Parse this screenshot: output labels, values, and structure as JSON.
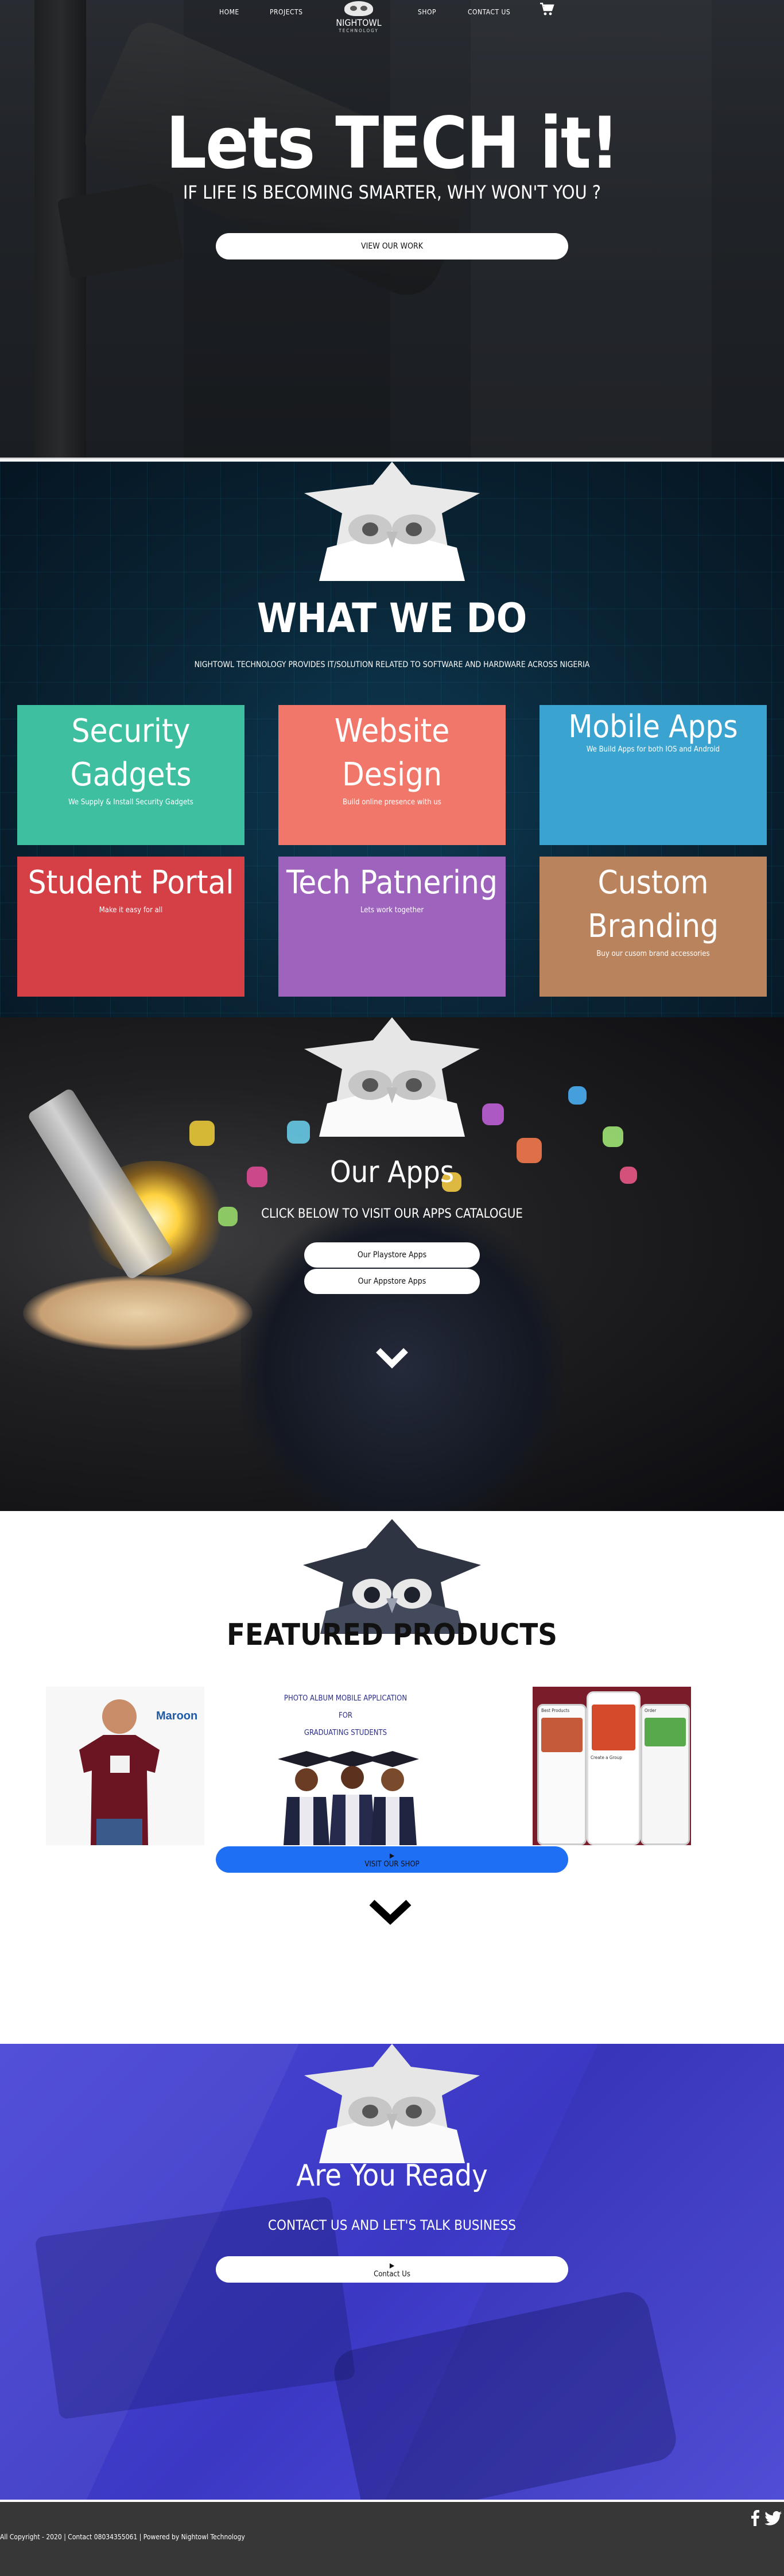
{
  "nav": {
    "links": [
      "HOME",
      "PROJECTS",
      "SHOP",
      "CONTACT US"
    ],
    "brand": "NIGHTOWL",
    "tagline": "TECHNOLOGY",
    "cart_icon": "cart-icon"
  },
  "hero": {
    "title": "Lets TECH it!",
    "subtitle": "IF LIFE IS BECOMING SMARTER, WHY WON'T YOU ?",
    "button": "VIEW OUR WORK"
  },
  "services": {
    "title": "WHAT WE DO",
    "description": "NIGHTOWL TECHNOLOGY PROVIDES IT/SOLUTION RELATED TO SOFTWARE AND HARDWARE ACROSS NIGERIA",
    "cards": [
      {
        "title": "Security Gadgets",
        "desc": "We Supply & Install Security Gadgets",
        "color": "#3dbfa0"
      },
      {
        "title": "Website Design",
        "desc": "Build online presence with us",
        "color": "#f0776a"
      },
      {
        "title": "Mobile Apps",
        "desc": "We Build Apps for both IOS and Android",
        "color": "#3aa3cf"
      },
      {
        "title": "Student Portal",
        "desc": "Make it easy for all",
        "color": "#d53f46"
      },
      {
        "title": "Tech Patnering",
        "desc": "Lets work together",
        "color": "#9d63bd"
      },
      {
        "title": "Custom Branding",
        "desc": "Buy our cusom brand accessories",
        "color": "#b9835d"
      }
    ]
  },
  "apps": {
    "title": "Our Apps",
    "cta": "CLICK BELOW TO VISIT OUR APPS CATALOGUE",
    "playstore": "Our Playstore Apps",
    "appstore": "Our Appstore Apps"
  },
  "featured": {
    "title": "FEATURED PRODUCTS",
    "shirt_label": "Maroon",
    "album_lines": [
      "PHOTO ALBUM MOBILE APPLICATION",
      "FOR",
      "GRADUATING STUDENTS"
    ],
    "button": "VISIT OUR SHOP",
    "phone_text": [
      "Best Products",
      "Create a Group",
      "Order"
    ]
  },
  "ready": {
    "title": "Are You Ready",
    "subtitle": "CONTACT US AND LET'S TALK BUSINESS",
    "button": "Contact Us"
  },
  "footer": {
    "copyright": "All Copyright - 2020 | Contact 08034355061 | Powered by Nightowl Technology",
    "icons": [
      "facebook-icon",
      "twitter-icon"
    ]
  },
  "colors": {
    "accent_blue": "#1f6ff5",
    "ready_bg": "#4a47d6",
    "footer_bg": "#373737"
  }
}
